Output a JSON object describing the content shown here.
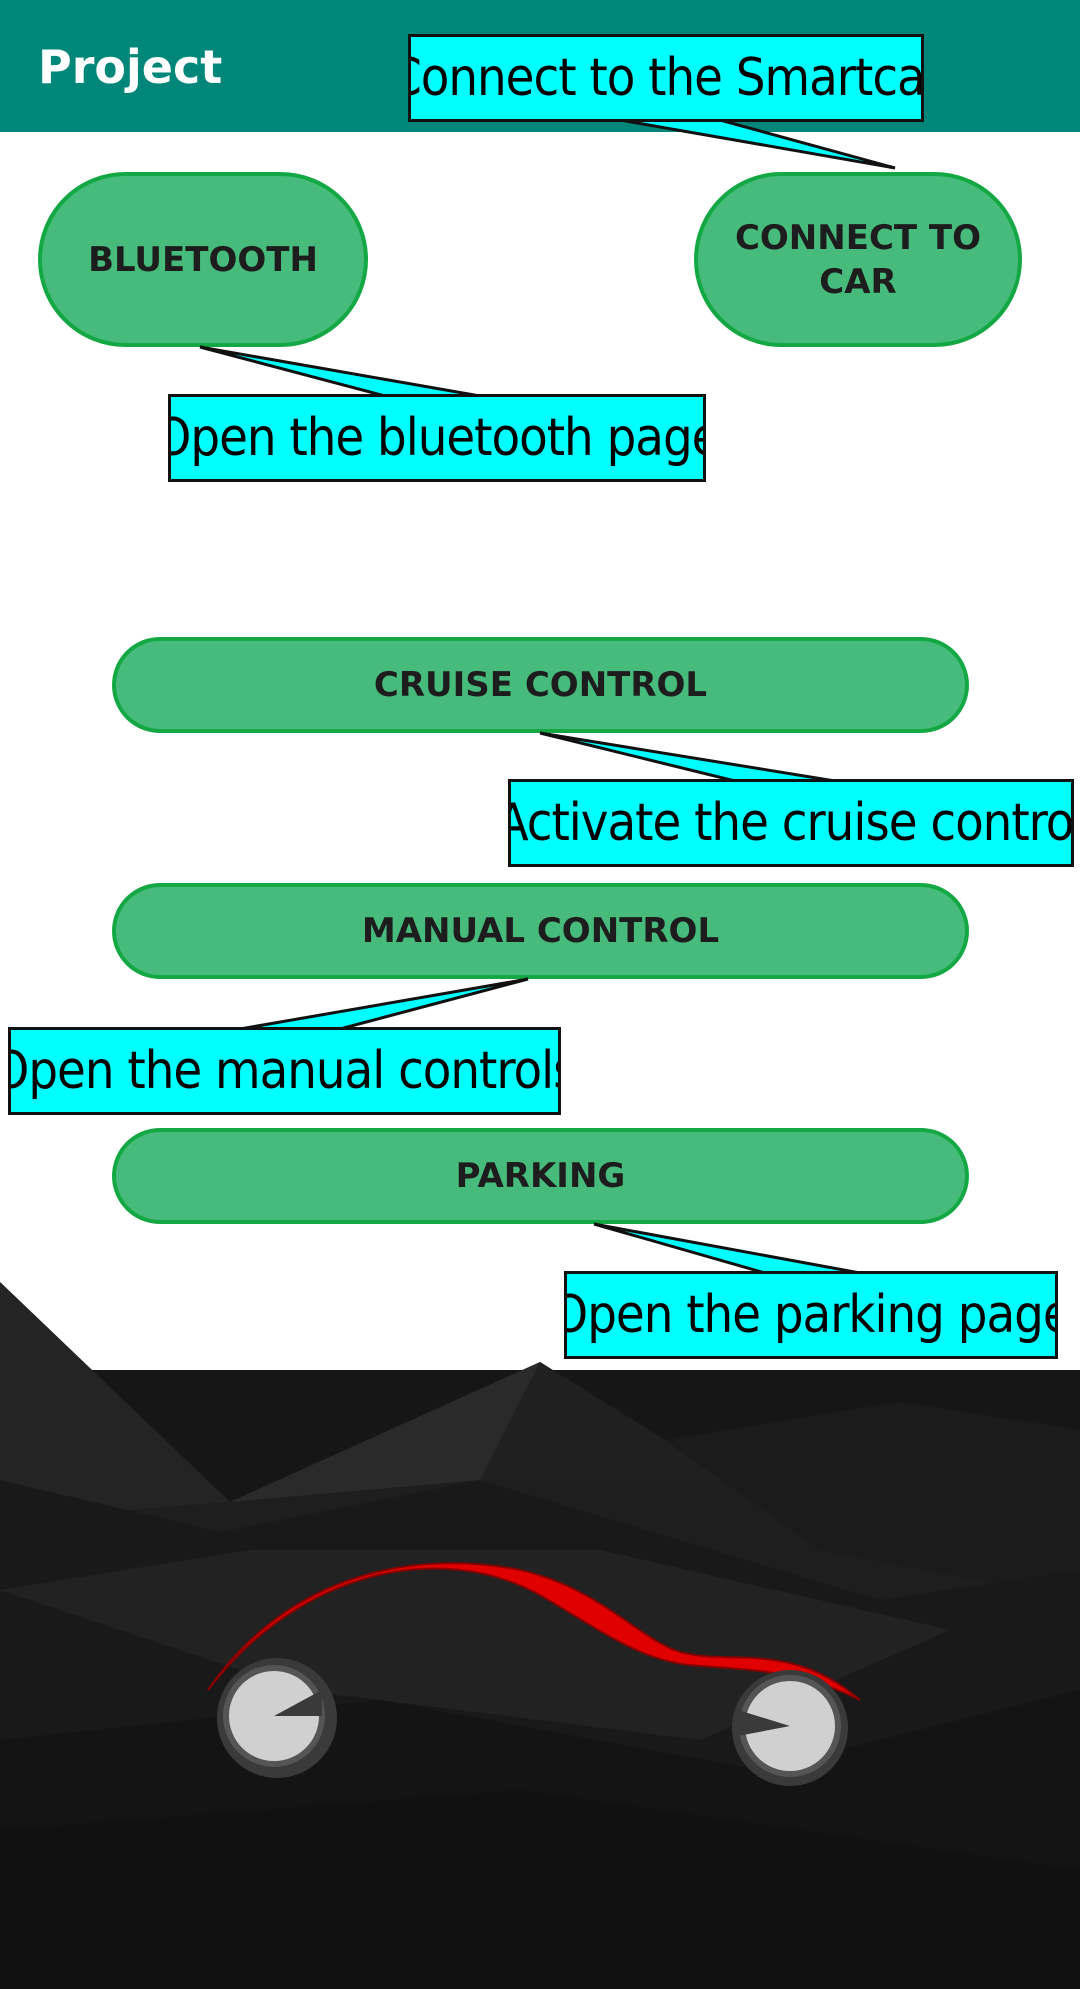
{
  "app": {
    "title": "Project"
  },
  "buttons": {
    "bluetooth": "BLUETOOTH",
    "connect_to_car": "CONNECT TO CAR",
    "cruise_control": "CRUISE CONTROL",
    "manual_control": "MANUAL CONTROL",
    "parking": "PARKING"
  },
  "callouts": {
    "connect": "Connect to the Smartcar",
    "bluetooth": "Open the bluetooth page",
    "cruise": "Activate the cruise control",
    "manual": "Open the manual controls",
    "parking": "Open the parking page"
  },
  "colors": {
    "appbar": "#00877a",
    "button_fill": "#47bb7b",
    "button_border": "#13a843",
    "callout_fill": "#00ffff",
    "car_body": "#e00000"
  },
  "icons": [
    "car-illustration-icon",
    "mountain-background-icon"
  ]
}
